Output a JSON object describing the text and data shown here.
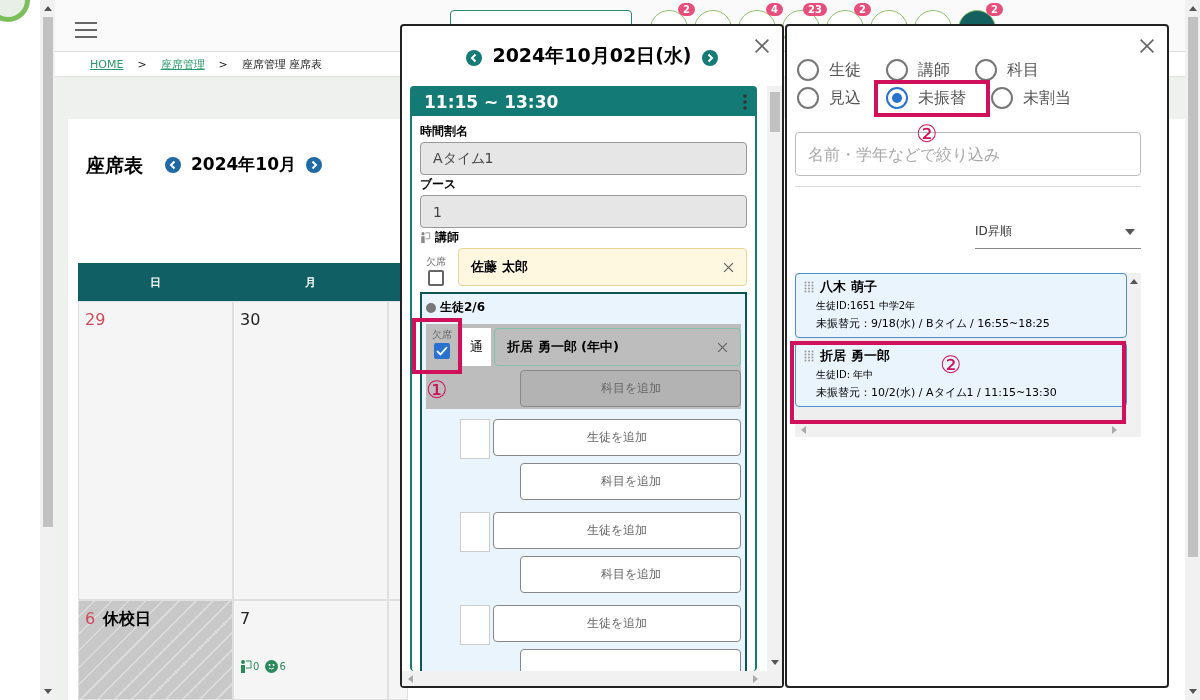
{
  "header": {
    "toolbar": [
      {
        "kind": "outline"
      },
      {
        "kind": "circle",
        "badge": "2"
      },
      {
        "kind": "circle"
      },
      {
        "kind": "circle",
        "badge": "4"
      },
      {
        "kind": "circle",
        "badge": "23"
      },
      {
        "kind": "circle",
        "badge": "2"
      },
      {
        "kind": "circle"
      },
      {
        "kind": "circle"
      },
      {
        "kind": "filled",
        "badge": "2"
      }
    ]
  },
  "breadcrumb": [
    {
      "label": "HOME",
      "link": true
    },
    {
      "label": ">",
      "link": false
    },
    {
      "label": "座席管理",
      "link": true
    },
    {
      "label": ">",
      "link": false
    },
    {
      "label": "座席管理 座席表",
      "link": false
    }
  ],
  "calendar": {
    "title": "座席表",
    "month": "2024年10月",
    "weekdays": [
      "日",
      "月"
    ],
    "weeks": [
      [
        {
          "day": "29",
          "sunday": true,
          "closed": false
        },
        {
          "day": "30",
          "sunday": false,
          "closed": false
        }
      ],
      [
        {
          "day": "6",
          "sunday": true,
          "closed": true,
          "note": "休校日"
        },
        {
          "day": "7",
          "sunday": false,
          "closed": false,
          "teachers": "0",
          "students": "6"
        }
      ]
    ]
  },
  "detail": {
    "date": "2024年10月02日(水)",
    "time": "11:15 ~ 13:30",
    "fields": [
      {
        "label": "時間割名",
        "value": "Aタイム1"
      },
      {
        "label": "ブース",
        "value": "1"
      }
    ],
    "teacher": {
      "label": "講師",
      "absent_label": "欠席",
      "absent": false,
      "name": "佐藤 太郎"
    },
    "students": {
      "label": "生徒2/6",
      "rows": [
        {
          "kind": "student",
          "absent_label": "欠席",
          "absent": true,
          "tag": "通",
          "name": "折居 勇一郎 (年中)",
          "subject": "科目を追加"
        },
        {
          "kind": "empty",
          "add": "生徒を追加",
          "subject": "科目を追加"
        },
        {
          "kind": "empty",
          "add": "生徒を追加",
          "subject": "科目を追加"
        },
        {
          "kind": "empty",
          "add": "生徒を追加"
        }
      ]
    }
  },
  "picker": {
    "options": [
      {
        "label": "生徒",
        "selected": false
      },
      {
        "label": "講師",
        "selected": false
      },
      {
        "label": "科目",
        "selected": false
      },
      {
        "label": "見込",
        "selected": false
      },
      {
        "label": "未振替",
        "selected": true
      },
      {
        "label": "未割当",
        "selected": false
      }
    ],
    "search": {
      "placeholder": "名前・学年などで絞り込み"
    },
    "sort": "ID昇順",
    "cards": [
      {
        "name": "八木 萌子",
        "info": "生徒ID:1651 中学2年",
        "source": "未振替元：9/18(水) / Bタイム / 16:55~18:25"
      },
      {
        "name": "折居 勇一郎",
        "info": "生徒ID: 年中",
        "source": "未振替元：10/2(水) / Aタイム1 / 11:15~13:30"
      }
    ]
  },
  "annotations": [
    "①",
    "②",
    "②"
  ]
}
